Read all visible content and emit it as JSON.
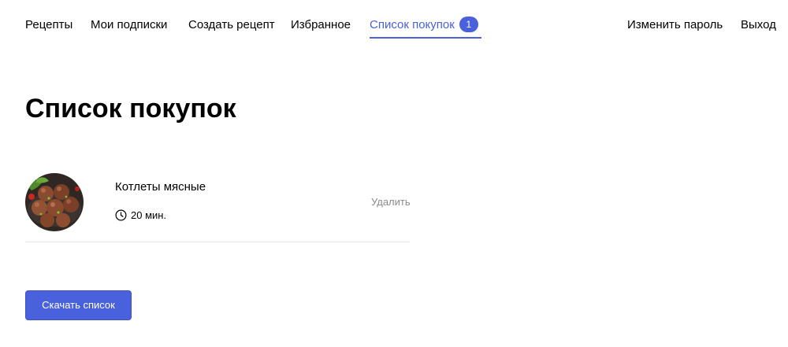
{
  "nav": {
    "recipes": "Рецепты",
    "subscriptions": "Мои подписки",
    "create_recipe": "Создать рецепт",
    "favorites": "Избранное",
    "shopping_list": "Список покупок",
    "shopping_list_count": "1",
    "change_password": "Изменить пароль",
    "logout": "Выход",
    "active_color": "#4a61dd"
  },
  "page": {
    "title": "Список покупок"
  },
  "items": [
    {
      "title": "Котлеты мясные",
      "time": "20 мин.",
      "delete_label": "Удалить",
      "time_icon": "clock-icon"
    }
  ],
  "download_button": {
    "label": "Скачать список",
    "color": "#4a61dd"
  }
}
